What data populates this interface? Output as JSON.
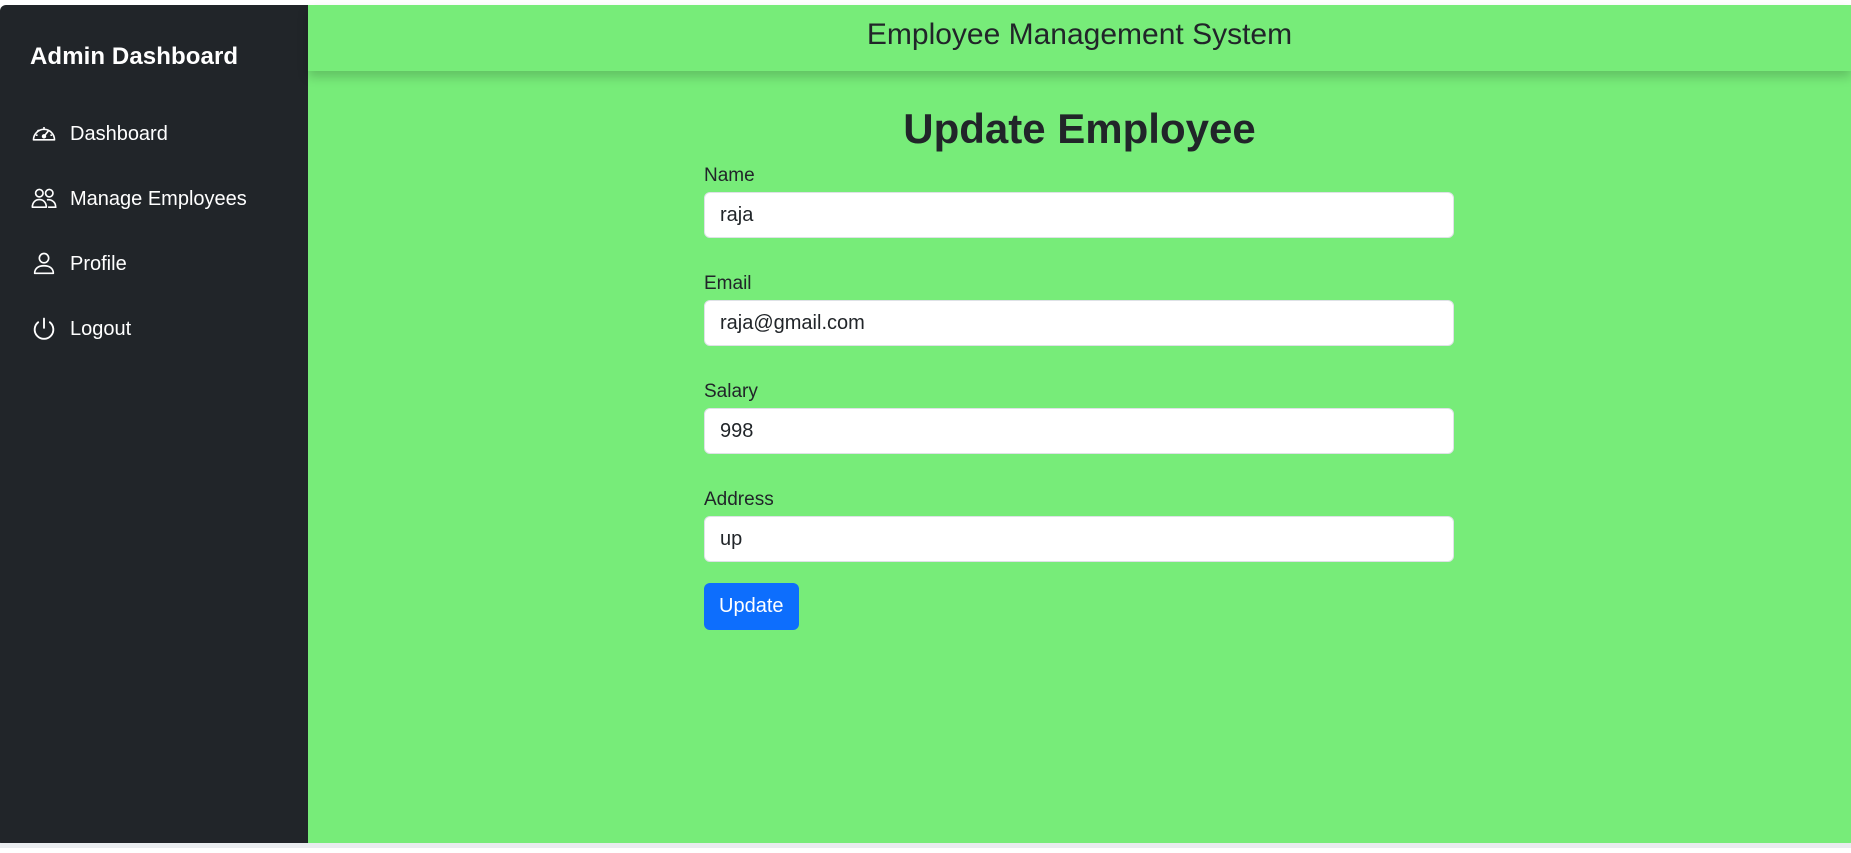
{
  "sidebar": {
    "brand": "Admin Dashboard",
    "items": [
      {
        "label": "Dashboard",
        "icon": "speedometer-icon"
      },
      {
        "label": "Manage Employees",
        "icon": "people-icon"
      },
      {
        "label": "Profile",
        "icon": "person-icon"
      },
      {
        "label": "Logout",
        "icon": "power-icon"
      }
    ]
  },
  "header": {
    "title": "Employee Management System"
  },
  "main": {
    "page_title": "Update Employee",
    "form": {
      "name_label": "Name",
      "name_value": "raja",
      "email_label": "Email",
      "email_value": "raja@gmail.com",
      "salary_label": "Salary",
      "salary_value": "998",
      "address_label": "Address",
      "address_value": "up",
      "submit_label": "Update"
    }
  },
  "colors": {
    "sidebar_bg": "#212529",
    "main_bg": "#77ec79",
    "button_primary": "#0d6efd"
  }
}
